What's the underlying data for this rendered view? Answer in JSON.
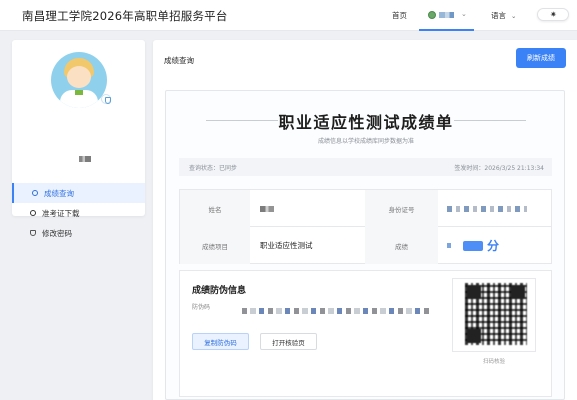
{
  "header": {
    "site_title": "南昌理工学院2026年高职单招服务平台",
    "nav_home": "首页",
    "nav_language": "语言",
    "theme_icon": "sun-icon"
  },
  "sidebar": {
    "items": [
      {
        "label": "成绩查询",
        "icon": "circle-icon",
        "active": true
      },
      {
        "label": "准考证下载",
        "icon": "circle-icon",
        "active": false
      },
      {
        "label": "修改密码",
        "icon": "shield-icon",
        "active": false
      }
    ]
  },
  "main": {
    "title": "成绩查询",
    "refresh_label": "刷新成绩"
  },
  "report": {
    "title": "职业适应性测试成绩单",
    "subtitle": "成绩信息以学校成绩库同步数据为准",
    "status": "查询状态：已同步",
    "issued": "签发时间：2026/3/25 21:13:34",
    "labels": {
      "name": "姓名",
      "id_number": "身份证号",
      "item": "成绩项目",
      "score": "成绩"
    },
    "item_value": "职业适应性测试",
    "score_unit": "分"
  },
  "security": {
    "title": "成绩防伪信息",
    "code_label": "防伪码",
    "copy_label": "复制防伪码",
    "open_label": "打开核验页",
    "qr_caption": "扫码核验"
  },
  "colors": {
    "accent": "#3b82f6",
    "active_bg": "#eaf2ff",
    "page_bg": "#eef0f4"
  }
}
